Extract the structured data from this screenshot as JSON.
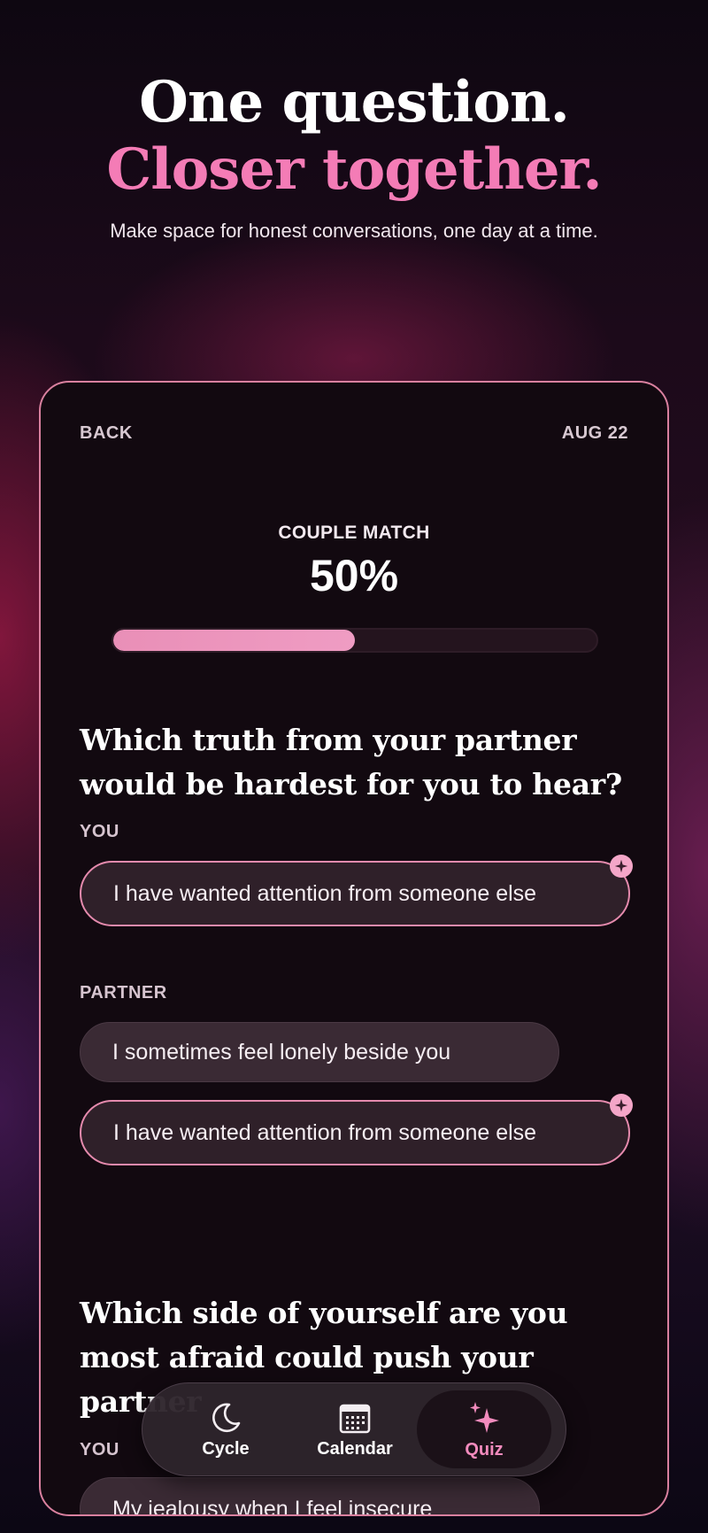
{
  "hero": {
    "line1": "One question.",
    "line2": "Closer together.",
    "subtitle": "Make space for honest conversations, one day at a time."
  },
  "screen": {
    "back_label": "BACK",
    "date": "AUG 22",
    "match": {
      "label": "COUPLE MATCH",
      "value": "50%",
      "progress_fraction": 0.5
    },
    "questions": [
      {
        "text": "Which truth from your partner would be hardest for you to hear?",
        "you_label": "YOU",
        "you_answer": "I have wanted attention from someone else",
        "partner_label": "PARTNER",
        "partner_answers": [
          "I sometimes feel lonely beside you",
          "I have wanted attention from someone else"
        ]
      },
      {
        "text": "Which side of yourself are you most afraid could push your partner",
        "you_label": "YOU",
        "you_answer": "My jealousy when I feel insecure"
      }
    ]
  },
  "nav": {
    "items": [
      {
        "label": "Cycle",
        "icon": "moon-icon"
      },
      {
        "label": "Calendar",
        "icon": "calendar-icon"
      },
      {
        "label": "Quiz",
        "icon": "sparkle-icon",
        "active": true
      }
    ]
  },
  "colors": {
    "accent_pink": "#f47cb6",
    "selected_border": "#e58aad",
    "progress_fill": "#ec94bd"
  }
}
